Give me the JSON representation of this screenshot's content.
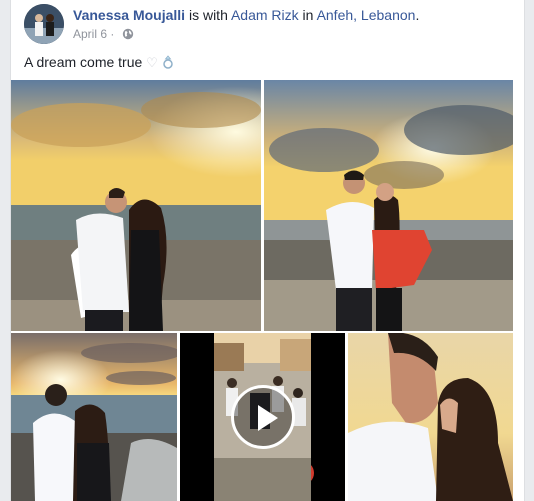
{
  "post": {
    "author": "Vanessa Moujalli",
    "with_prefix": " is with ",
    "tagged": "Adam Rizk",
    "in_prefix": " in ",
    "location": "Anfeh, Lebanon",
    "period": ".",
    "date": "April 6",
    "separator": " · ",
    "privacy_icon": "globe-icon",
    "text": "A dream come true"
  },
  "colors": {
    "link": "#385898",
    "meta": "#90949c",
    "card_bg": "#ffffff",
    "page_bg": "#e9ebee"
  }
}
